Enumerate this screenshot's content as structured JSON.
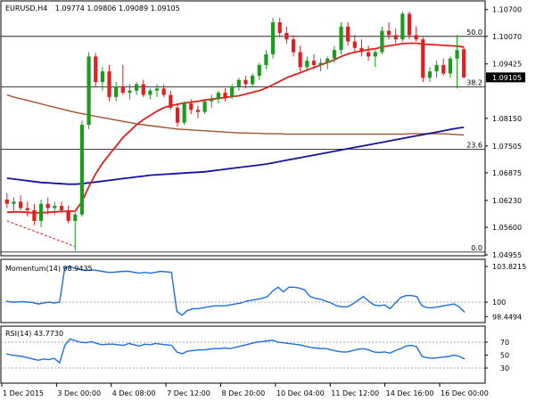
{
  "header": {
    "symbol": "EURUSD,H4",
    "ohlc": "1.09774 1.09806 1.09089 1.09105"
  },
  "current_price_tag": "1.09105",
  "colors": {
    "bull": "#1e9a1e",
    "bear": "#e02020",
    "ma_fast": "#e02020",
    "ma_mid": "#1414a0",
    "ma_slow": "#a0522d",
    "indicator_line": "#1e6fd9",
    "price_tag_bg": "#000000",
    "border": "#000000"
  },
  "chart_data": [
    {
      "type": "candlestick",
      "panel": "price",
      "title": "EURUSD,H4 1.09774 1.09806 1.09089 1.09105",
      "x_ticks": [
        "1 Dec 2015",
        "3 Dec 00:00",
        "4 Dec 08:00",
        "7 Dec 12:00",
        "8 Dec 20:00",
        "10 Dec 04:00",
        "11 Dec 12:00",
        "14 Dec 16:00",
        "16 Dec 00:00"
      ],
      "y_ticks": [
        "1.10700",
        "1.10070",
        "1.09425",
        "1.08150",
        "1.07505",
        "1.06875",
        "1.06230",
        "1.05600",
        "1.04955"
      ],
      "ylim": [
        1.04955,
        1.1088
      ],
      "fib_levels": [
        {
          "label": "50.0",
          "value": 1.1007
        },
        {
          "label": "38.2",
          "value": 1.0889
        },
        {
          "label": "23.6",
          "value": 1.0743
        },
        {
          "label": "0.0",
          "value": 1.0502
        }
      ],
      "candles": [
        {
          "o": 1.0625,
          "h": 1.064,
          "l": 1.0605,
          "c": 1.0615
        },
        {
          "o": 1.0615,
          "h": 1.063,
          "l": 1.0595,
          "c": 1.062
        },
        {
          "o": 1.062,
          "h": 1.0635,
          "l": 1.06,
          "c": 1.0605
        },
        {
          "o": 1.0605,
          "h": 1.062,
          "l": 1.0585,
          "c": 1.06
        },
        {
          "o": 1.06,
          "h": 1.0615,
          "l": 1.0565,
          "c": 1.0575
        },
        {
          "o": 1.0575,
          "h": 1.0625,
          "l": 1.056,
          "c": 1.0615
        },
        {
          "o": 1.0615,
          "h": 1.063,
          "l": 1.059,
          "c": 1.0605
        },
        {
          "o": 1.0605,
          "h": 1.062,
          "l": 1.059,
          "c": 1.061
        },
        {
          "o": 1.061,
          "h": 1.062,
          "l": 1.0595,
          "c": 1.06
        },
        {
          "o": 1.06,
          "h": 1.061,
          "l": 1.057,
          "c": 1.0575
        },
        {
          "o": 1.0575,
          "h": 1.0595,
          "l": 1.0505,
          "c": 1.059
        },
        {
          "o": 1.059,
          "h": 1.081,
          "l": 1.0585,
          "c": 1.08
        },
        {
          "o": 1.08,
          "h": 1.097,
          "l": 1.079,
          "c": 1.096
        },
        {
          "o": 1.096,
          "h": 1.0968,
          "l": 1.089,
          "c": 1.09
        },
        {
          "o": 1.09,
          "h": 1.0935,
          "l": 1.088,
          "c": 1.0925
        },
        {
          "o": 1.0925,
          "h": 1.094,
          "l": 1.0855,
          "c": 1.0865
        },
        {
          "o": 1.0865,
          "h": 1.09,
          "l": 1.0855,
          "c": 1.089
        },
        {
          "o": 1.089,
          "h": 1.094,
          "l": 1.087,
          "c": 1.0875
        },
        {
          "o": 1.0875,
          "h": 1.0895,
          "l": 1.086,
          "c": 1.088
        },
        {
          "o": 1.088,
          "h": 1.09,
          "l": 1.087,
          "c": 1.0895
        },
        {
          "o": 1.0895,
          "h": 1.0905,
          "l": 1.0865,
          "c": 1.087
        },
        {
          "o": 1.087,
          "h": 1.0885,
          "l": 1.086,
          "c": 1.088
        },
        {
          "o": 1.088,
          "h": 1.0895,
          "l": 1.0865,
          "c": 1.0885
        },
        {
          "o": 1.0885,
          "h": 1.0895,
          "l": 1.0865,
          "c": 1.087
        },
        {
          "o": 1.087,
          "h": 1.088,
          "l": 1.0835,
          "c": 1.084
        },
        {
          "o": 1.084,
          "h": 1.085,
          "l": 1.0795,
          "c": 1.0805
        },
        {
          "o": 1.0805,
          "h": 1.0855,
          "l": 1.08,
          "c": 1.085
        },
        {
          "o": 1.085,
          "h": 1.086,
          "l": 1.0825,
          "c": 1.0835
        },
        {
          "o": 1.0835,
          "h": 1.0845,
          "l": 1.0815,
          "c": 1.083
        },
        {
          "o": 1.083,
          "h": 1.086,
          "l": 1.0825,
          "c": 1.0855
        },
        {
          "o": 1.0855,
          "h": 1.087,
          "l": 1.084,
          "c": 1.086
        },
        {
          "o": 1.086,
          "h": 1.088,
          "l": 1.085,
          "c": 1.0875
        },
        {
          "o": 1.0875,
          "h": 1.0885,
          "l": 1.0855,
          "c": 1.0865
        },
        {
          "o": 1.0865,
          "h": 1.0895,
          "l": 1.086,
          "c": 1.089
        },
        {
          "o": 1.089,
          "h": 1.091,
          "l": 1.088,
          "c": 1.0905
        },
        {
          "o": 1.0905,
          "h": 1.0915,
          "l": 1.0885,
          "c": 1.0895
        },
        {
          "o": 1.0895,
          "h": 1.092,
          "l": 1.089,
          "c": 1.0915
        },
        {
          "o": 1.0915,
          "h": 1.0945,
          "l": 1.0905,
          "c": 1.094
        },
        {
          "o": 1.094,
          "h": 1.0975,
          "l": 1.093,
          "c": 1.0965
        },
        {
          "o": 1.0965,
          "h": 1.105,
          "l": 1.0955,
          "c": 1.104
        },
        {
          "o": 1.104,
          "h": 1.105,
          "l": 1.1005,
          "c": 1.1015
        },
        {
          "o": 1.1015,
          "h": 1.103,
          "l": 1.099,
          "c": 1.1
        },
        {
          "o": 1.1,
          "h": 1.101,
          "l": 1.096,
          "c": 1.097
        },
        {
          "o": 1.097,
          "h": 1.0985,
          "l": 1.0925,
          "c": 1.0935
        },
        {
          "o": 1.0935,
          "h": 1.096,
          "l": 1.0925,
          "c": 1.095
        },
        {
          "o": 1.095,
          "h": 1.0965,
          "l": 1.093,
          "c": 1.094
        },
        {
          "o": 1.094,
          "h": 1.0955,
          "l": 1.0925,
          "c": 1.0945
        },
        {
          "o": 1.0945,
          "h": 1.096,
          "l": 1.093,
          "c": 1.0955
        },
        {
          "o": 1.0955,
          "h": 1.0985,
          "l": 1.0945,
          "c": 1.0975
        },
        {
          "o": 1.0975,
          "h": 1.104,
          "l": 1.0965,
          "c": 1.103
        },
        {
          "o": 1.103,
          "h": 1.104,
          "l": 1.0985,
          "c": 1.0995
        },
        {
          "o": 1.0995,
          "h": 1.101,
          "l": 1.097,
          "c": 1.098
        },
        {
          "o": 1.098,
          "h": 1.1,
          "l": 1.096,
          "c": 1.097
        },
        {
          "o": 1.097,
          "h": 1.0985,
          "l": 1.095,
          "c": 1.096
        },
        {
          "o": 1.096,
          "h": 1.0975,
          "l": 1.0935,
          "c": 1.097
        },
        {
          "o": 1.097,
          "h": 1.103,
          "l": 1.0965,
          "c": 1.102
        },
        {
          "o": 1.102,
          "h": 1.104,
          "l": 1.1,
          "c": 1.101
        },
        {
          "o": 1.101,
          "h": 1.1025,
          "l": 1.099,
          "c": 1.1
        },
        {
          "o": 1.1,
          "h": 1.1065,
          "l": 1.0995,
          "c": 1.106
        },
        {
          "o": 1.106,
          "h": 1.1065,
          "l": 1.1,
          "c": 1.101
        },
        {
          "o": 1.101,
          "h": 1.103,
          "l": 1.0995,
          "c": 1.1
        },
        {
          "o": 1.1,
          "h": 1.1005,
          "l": 1.09,
          "c": 1.091
        },
        {
          "o": 1.091,
          "h": 1.0935,
          "l": 1.09,
          "c": 1.0925
        },
        {
          "o": 1.0925,
          "h": 1.095,
          "l": 1.091,
          "c": 1.094
        },
        {
          "o": 1.094,
          "h": 1.0955,
          "l": 1.0915,
          "c": 1.092
        },
        {
          "o": 1.092,
          "h": 1.096,
          "l": 1.091,
          "c": 1.0955
        },
        {
          "o": 1.0955,
          "h": 1.101,
          "l": 1.0885,
          "c": 1.0975
        },
        {
          "o": 1.0977,
          "h": 1.0981,
          "l": 1.0909,
          "c": 1.0911
        }
      ],
      "ma_fast": [
        1.0595,
        1.0596,
        1.0596,
        1.0595,
        1.0594,
        1.0594,
        1.0595,
        1.0596,
        1.0597,
        1.0597,
        1.0598,
        1.062,
        1.0655,
        1.0685,
        1.071,
        1.073,
        1.075,
        1.077,
        1.0785,
        1.08,
        1.0812,
        1.0822,
        1.0832,
        1.084,
        1.0845,
        1.0848,
        1.0851,
        1.0853,
        1.0855,
        1.0858,
        1.086,
        1.0862,
        1.0864,
        1.0866,
        1.0868,
        1.0872,
        1.0876,
        1.088,
        1.0886,
        1.0894,
        1.0902,
        1.091,
        1.0916,
        1.0922,
        1.0928,
        1.0934,
        1.094,
        1.0946,
        1.0952,
        1.096,
        1.0966,
        1.097,
        1.0973,
        1.0976,
        1.0978,
        1.0982,
        1.0985,
        1.0987,
        1.099,
        1.0991,
        1.0991,
        1.0989,
        1.0988,
        1.0987,
        1.0986,
        1.0985,
        1.0984,
        1.0982
      ],
      "ma_mid": [
        1.0675,
        1.0673,
        1.0671,
        1.0669,
        1.0667,
        1.0665,
        1.0664,
        1.0663,
        1.0662,
        1.0661,
        1.0661,
        1.0662,
        1.0664,
        1.0666,
        1.0668,
        1.067,
        1.0672,
        1.0674,
        1.0676,
        1.0678,
        1.068,
        1.0682,
        1.0683,
        1.0684,
        1.0685,
        1.0686,
        1.0687,
        1.0688,
        1.0689,
        1.069,
        1.0692,
        1.0694,
        1.0696,
        1.0698,
        1.07,
        1.0702,
        1.0704,
        1.0706,
        1.0708,
        1.0711,
        1.0714,
        1.0717,
        1.072,
        1.0723,
        1.0726,
        1.0729,
        1.0732,
        1.0735,
        1.0738,
        1.0741,
        1.0744,
        1.0747,
        1.075,
        1.0753,
        1.0756,
        1.0759,
        1.0762,
        1.0765,
        1.0768,
        1.0771,
        1.0774,
        1.0777,
        1.078,
        1.0783,
        1.0786,
        1.0789,
        1.0792,
        1.0794
      ],
      "ma_slow": [
        1.087,
        1.0865,
        1.0861,
        1.0857,
        1.0853,
        1.0849,
        1.0845,
        1.0841,
        1.0837,
        1.0833,
        1.0829,
        1.0826,
        1.0823,
        1.082,
        1.0817,
        1.0814,
        1.0811,
        1.0808,
        1.0805,
        1.0802,
        1.08,
        1.0798,
        1.0796,
        1.0794,
        1.0792,
        1.079,
        1.0789,
        1.0788,
        1.0787,
        1.0786,
        1.0785,
        1.0784,
        1.0783,
        1.0782,
        1.0781,
        1.0781,
        1.078,
        1.078,
        1.0779,
        1.0779,
        1.0779,
        1.0778,
        1.0778,
        1.0778,
        1.0778,
        1.0778,
        1.0778,
        1.0778,
        1.0778,
        1.0778,
        1.0778,
        1.0778,
        1.0778,
        1.0778,
        1.0778,
        1.0778,
        1.0778,
        1.0778,
        1.0778,
        1.0779,
        1.0779,
        1.0779,
        1.0779,
        1.0779,
        1.0779,
        1.0778,
        1.0777,
        1.0776
      ],
      "dashed_line": {
        "from": 1.0575,
        "to": 1.0515,
        "bars": 11
      }
    },
    {
      "type": "line",
      "panel": "momentum",
      "title": "Momentum(14) 98.9435",
      "y_ticks": [
        "103.8215",
        "100",
        "98.4494"
      ],
      "ylim": [
        97.9,
        104.4
      ],
      "reference": 100,
      "values": [
        100.1,
        100.0,
        100.0,
        100.05,
        100.0,
        99.95,
        99.8,
        99.9,
        100.0,
        99.9,
        100.0,
        103.7,
        103.8,
        103.6,
        103.5,
        103.4,
        103.45,
        103.4,
        103.3,
        103.2,
        103.2,
        103.25,
        103.3,
        103.3,
        103.2,
        103.1,
        103.2,
        103.1,
        103.2,
        103.3,
        103.25,
        103.2,
        99.0,
        98.6,
        99.1,
        99.3,
        99.3,
        99.4,
        99.5,
        99.6,
        99.6,
        99.6,
        99.7,
        99.8,
        99.9,
        100.1,
        100.2,
        100.3,
        100.4,
        100.6,
        101.2,
        101.6,
        101.1,
        101.6,
        101.6,
        101.5,
        101.3,
        100.6,
        100.4,
        100.3,
        100.1,
        99.9,
        99.6,
        99.5,
        99.5,
        99.8,
        100.2,
        100.6,
        100.1,
        99.7,
        99.6,
        99.7,
        99.3,
        99.9,
        100.5,
        100.7,
        100.7,
        100.6,
        99.6,
        99.4,
        99.4,
        99.5,
        99.6,
        99.7,
        99.8,
        99.5,
        98.9
      ]
    },
    {
      "type": "line",
      "panel": "rsi",
      "title": "RSI(14) 43.7730",
      "y_ticks": [
        "70",
        "50",
        "30"
      ],
      "ylim": [
        8,
        92
      ],
      "levels": [
        70,
        30
      ],
      "values": [
        52,
        50,
        49,
        48,
        46,
        44,
        42,
        44,
        43,
        45,
        38,
        65,
        75,
        72,
        70,
        69,
        71,
        68,
        66,
        67,
        67,
        66,
        65,
        68,
        66,
        64,
        67,
        66,
        68,
        67,
        66,
        65,
        55,
        52,
        56,
        57,
        58,
        58,
        59,
        60,
        60,
        61,
        60,
        62,
        64,
        66,
        68,
        70,
        71,
        72,
        73,
        70,
        69,
        68,
        67,
        66,
        64,
        62,
        61,
        60,
        60,
        58,
        56,
        55,
        55,
        57,
        59,
        60,
        58,
        55,
        54,
        55,
        53,
        57,
        60,
        64,
        65,
        63,
        48,
        46,
        45,
        46,
        47,
        48,
        50,
        48,
        44
      ]
    }
  ]
}
